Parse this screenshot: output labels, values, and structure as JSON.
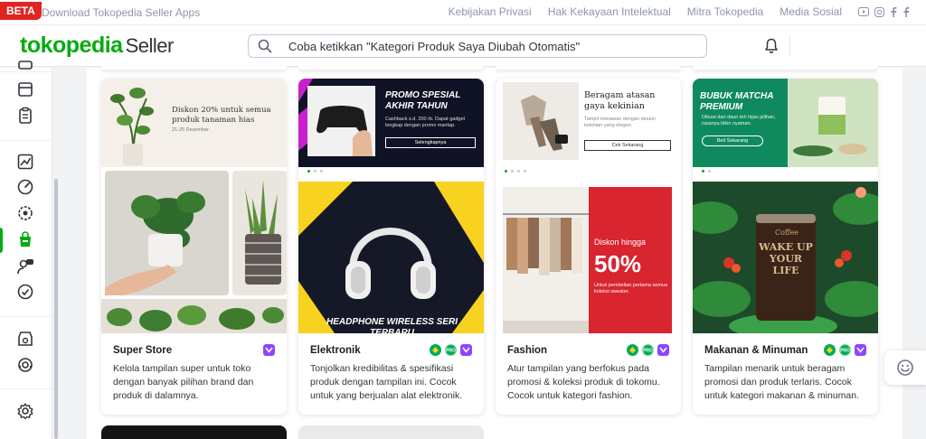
{
  "topbar": {
    "beta": "BETA",
    "download": "Download Tokopedia Seller Apps",
    "links": [
      "Kebijakan Privasi",
      "Hak Kekayaan Intelektual",
      "Mitra Tokopedia",
      "Media Sosial"
    ]
  },
  "header": {
    "logo_brand": "tokopedia",
    "logo_suffix": "Seller",
    "search_placeholder": "Coba ketikkan \"Kategori Produk Saya Diubah Otomatis\""
  },
  "cards": [
    {
      "title": "Super Store",
      "desc": "Kelola tampilan super untuk toko dengan banyak pilihan brand dan produk di dalamnya.",
      "banner": {
        "headline": "Diskon 20% untuk semua produk tanaman hias",
        "date": "21-25 Desember"
      }
    },
    {
      "title": "Elektronik",
      "desc": "Tonjolkan kredibilitas & spesifikasi produk dengan tampilan ini. Cocok untuk yang berjualan alat elektronik.",
      "banner": {
        "headline": "PROMO SPESIAL AKHIR TAHUN",
        "sub": "Cashback s.d. 200 rb. Dapat gadget lengkap dengan promo mantap.",
        "button": "Selengkapnya",
        "bottom": "HEADPHONE WIRELESS SERI TERBARU"
      }
    },
    {
      "title": "Fashion",
      "desc": "Atur tampilan yang berfokus pada promosi & koleksi produk di tokomu. Cocok untuk kategori fashion.",
      "banner": {
        "headline": "Beragam atasan gaya kekinian",
        "sub": "Tampil menawan dengan desain kekinian yang elegan.",
        "button": "Cek Sekarang",
        "promo_label": "Diskon hingga",
        "promo_value": "50%",
        "promo_sub": "Untuk pembelian pertama semua koleksi sweater."
      }
    },
    {
      "title": "Makanan & Minuman",
      "desc": "Tampilan menarik untuk beragam promosi dan produk terlaris. Cocok untuk kategori makanan & minuman.",
      "banner": {
        "headline": "BUBUK MATCHA PREMIUM",
        "sub": "Dibuat dari daun teh hijau pilihan, rasanya bikin nyaman.",
        "button": "Beli Sekarang",
        "can_top": "Coffee",
        "can_main": "WAKE UP YOUR LIFE"
      }
    }
  ],
  "colors": {
    "brand_green": "#03ac0e",
    "beta_red": "#e02424",
    "power_merchant_purple": "#8c46ff"
  }
}
